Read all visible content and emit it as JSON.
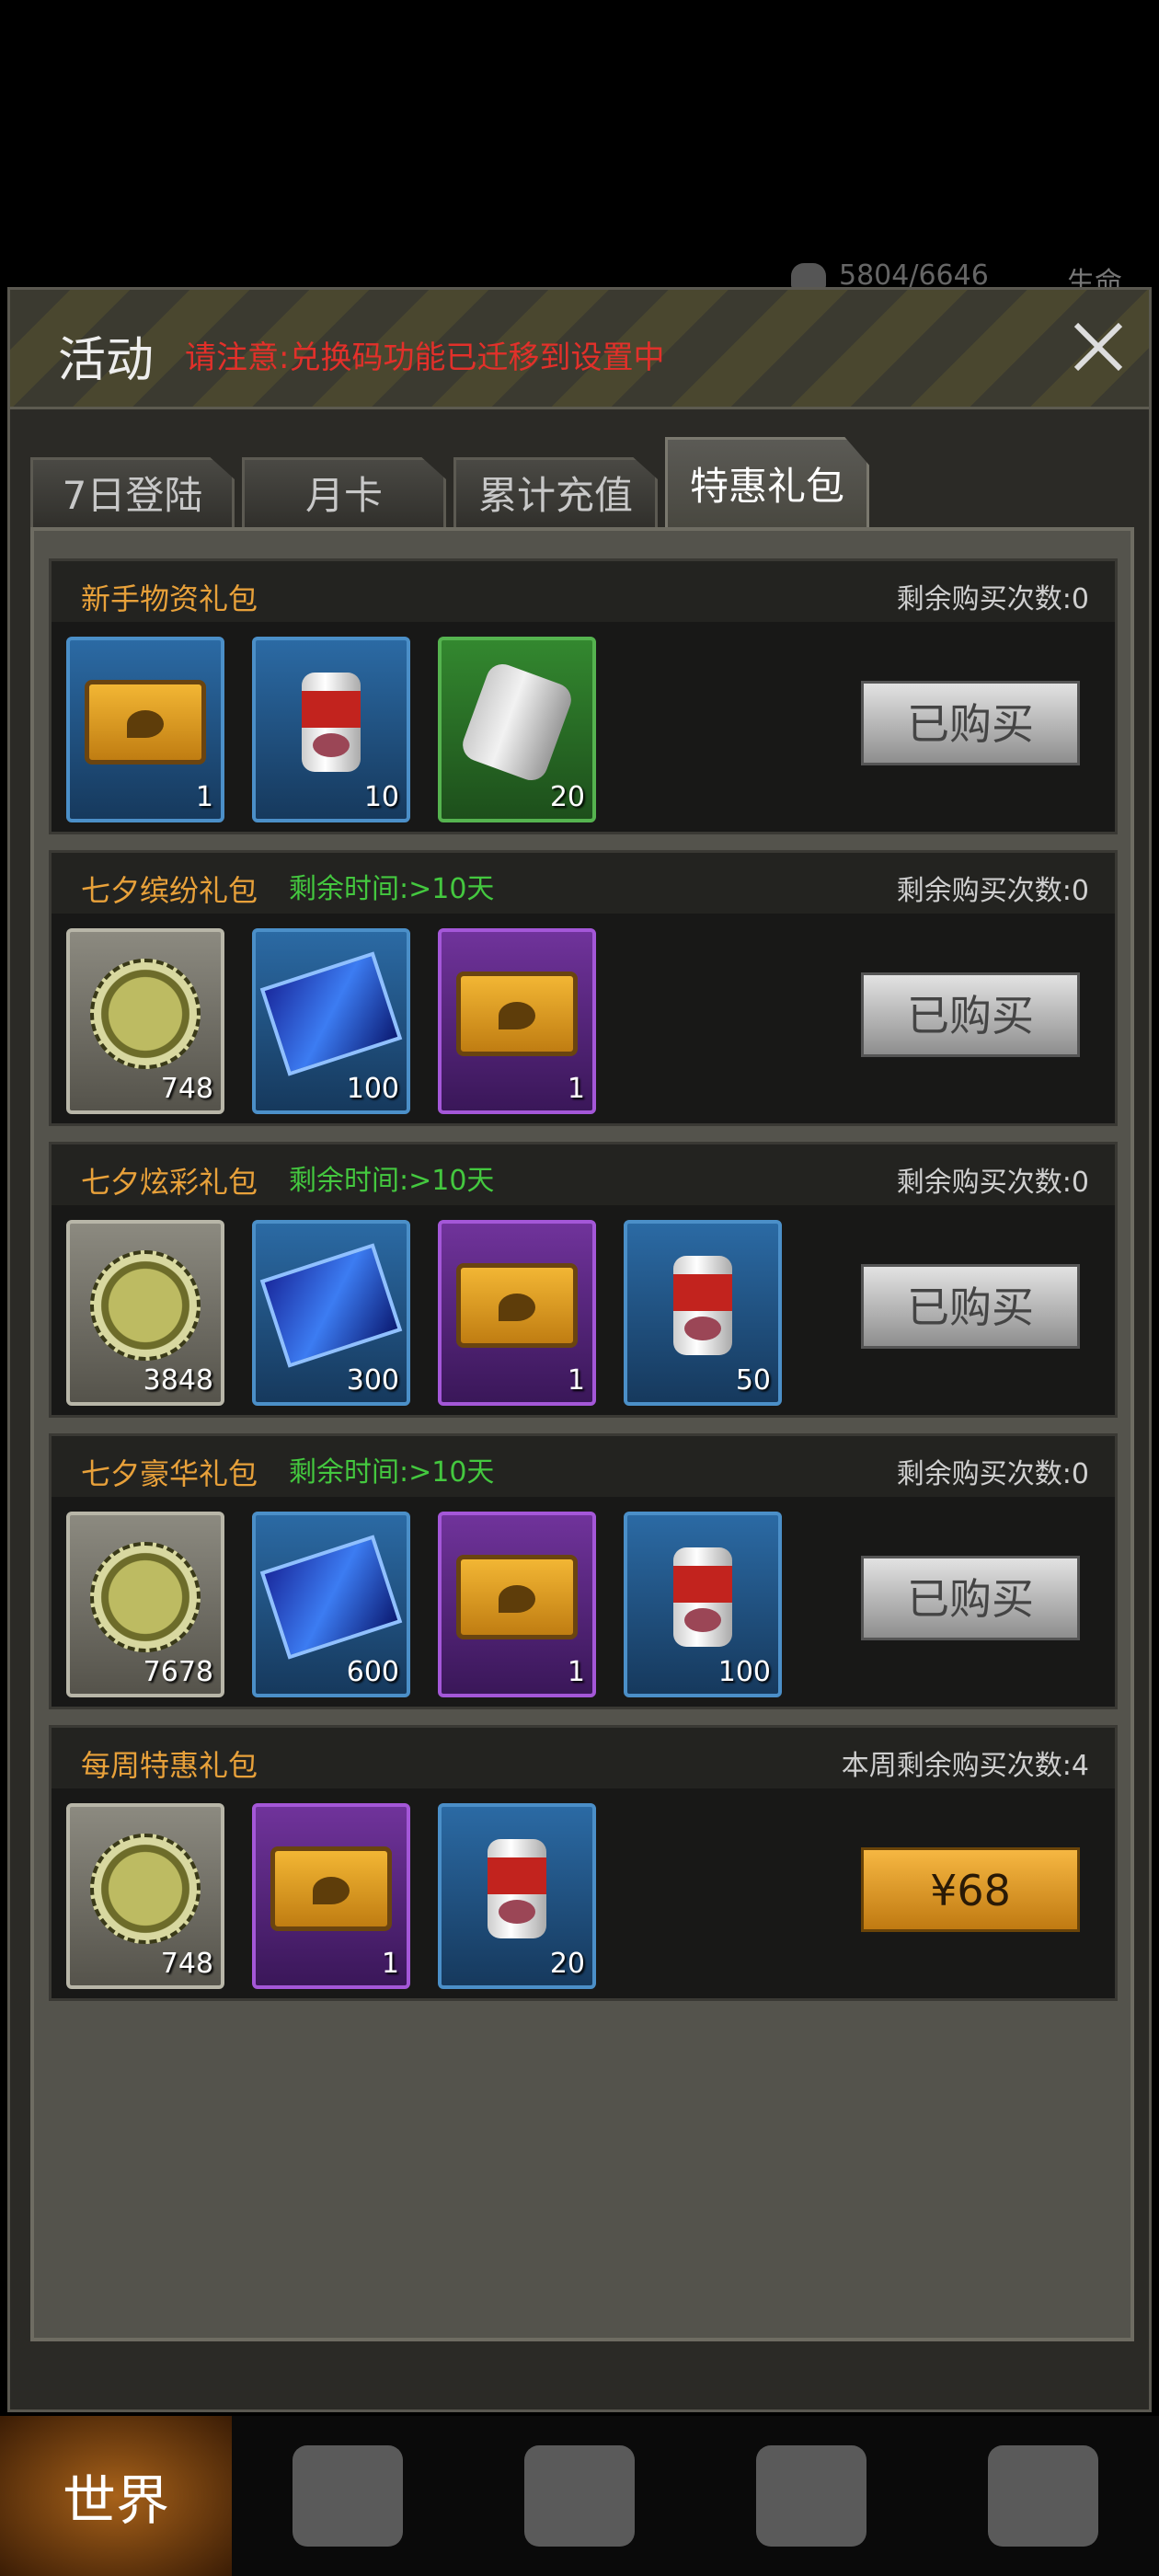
{
  "hud": {
    "stat_value": "5804/6646",
    "life_label": "生命"
  },
  "dialog": {
    "title": "活动",
    "notice": "请注意:兑换码功能已迁移到设置中",
    "close_icon": "close-icon"
  },
  "tabs": [
    {
      "label": "7日登陆",
      "active": false
    },
    {
      "label": "月卡",
      "active": false
    },
    {
      "label": "累计充值",
      "active": false
    },
    {
      "label": "特惠礼包",
      "active": true
    }
  ],
  "packs": [
    {
      "name": "新手物资礼包",
      "timer": "",
      "remaining": "剩余购买次数:0",
      "items": [
        {
          "icon": "crate-icon",
          "rarity": "blue",
          "count": "1"
        },
        {
          "icon": "meat-can-icon",
          "rarity": "blue",
          "count": "10"
        },
        {
          "icon": "bandage-icon",
          "rarity": "green",
          "count": "20"
        }
      ],
      "button": "已购买",
      "button_state": "bought"
    },
    {
      "name": "七夕缤纷礼包",
      "timer": "剩余时间:>10天",
      "remaining": "剩余购买次数:0",
      "items": [
        {
          "icon": "bottle-cap-icon",
          "rarity": "gray",
          "count": "748"
        },
        {
          "icon": "qixi-card-icon",
          "rarity": "blue",
          "count": "100"
        },
        {
          "icon": "crate-icon",
          "rarity": "purple",
          "count": "1"
        }
      ],
      "button": "已购买",
      "button_state": "bought"
    },
    {
      "name": "七夕炫彩礼包",
      "timer": "剩余时间:>10天",
      "remaining": "剩余购买次数:0",
      "items": [
        {
          "icon": "bottle-cap-icon",
          "rarity": "gray",
          "count": "3848"
        },
        {
          "icon": "qixi-card-icon",
          "rarity": "blue",
          "count": "300"
        },
        {
          "icon": "crate-icon",
          "rarity": "purple",
          "count": "1"
        },
        {
          "icon": "meat-can-icon",
          "rarity": "blue",
          "count": "50"
        }
      ],
      "button": "已购买",
      "button_state": "bought"
    },
    {
      "name": "七夕豪华礼包",
      "timer": "剩余时间:>10天",
      "remaining": "剩余购买次数:0",
      "items": [
        {
          "icon": "bottle-cap-icon",
          "rarity": "gray",
          "count": "7678"
        },
        {
          "icon": "qixi-card-icon",
          "rarity": "blue",
          "count": "600"
        },
        {
          "icon": "crate-icon",
          "rarity": "purple",
          "count": "1"
        },
        {
          "icon": "meat-can-icon",
          "rarity": "blue",
          "count": "100"
        }
      ],
      "button": "已购买",
      "button_state": "bought"
    },
    {
      "name": "每周特惠礼包",
      "timer": "",
      "remaining": "本周剩余购买次数:4",
      "items": [
        {
          "icon": "bottle-cap-icon",
          "rarity": "gray",
          "count": "748"
        },
        {
          "icon": "crate-icon",
          "rarity": "purple",
          "count": "1"
        },
        {
          "icon": "meat-can-icon",
          "rarity": "blue",
          "count": "20"
        }
      ],
      "button": "¥68",
      "button_state": "buy"
    }
  ],
  "bottom_nav": [
    {
      "label": "世界",
      "icon": "globe-icon",
      "active": true
    },
    {
      "label": "",
      "icon": "backpack-icon",
      "active": false
    },
    {
      "label": "",
      "icon": "character-icon",
      "active": false
    },
    {
      "label": "",
      "icon": "building-icon",
      "active": false
    },
    {
      "label": "",
      "icon": "shopping-cart-icon",
      "active": false
    }
  ],
  "colors": {
    "accent_orange": "#e8a13a",
    "timer_green": "#44c83f",
    "notice_red": "#e2302a"
  }
}
